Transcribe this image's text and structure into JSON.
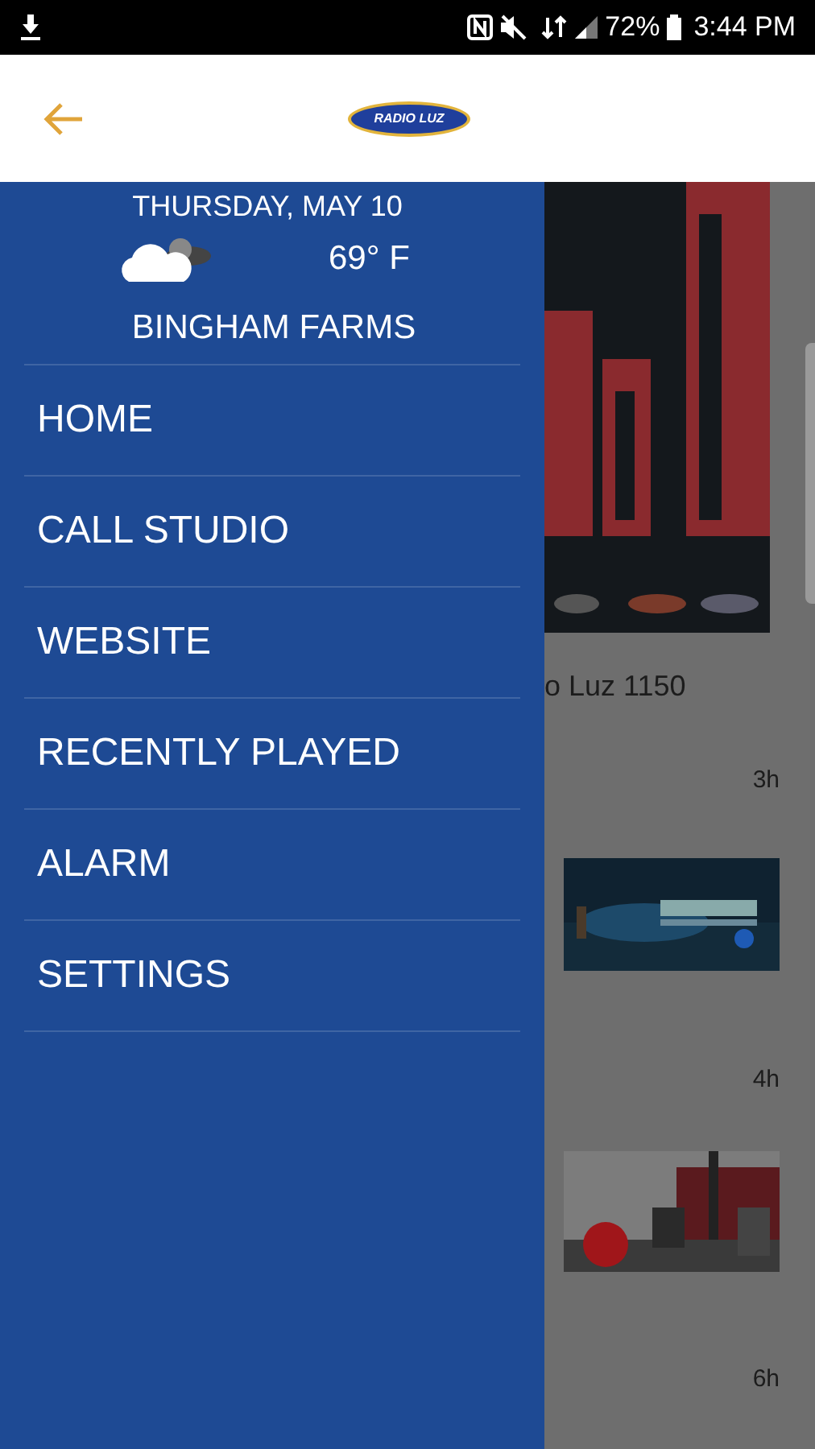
{
  "status_bar": {
    "battery": "72%",
    "time": "3:44 PM"
  },
  "app_bar": {
    "logo_text": "RADIO LUZ"
  },
  "drawer": {
    "date": "THURSDAY, MAY 10",
    "temperature": "69° F",
    "location": "BINGHAM FARMS",
    "items": [
      "HOME",
      "CALL STUDIO",
      "WEBSITE",
      "RECENTLY PLAYED",
      "ALARM",
      "SETTINGS"
    ]
  },
  "feed": {
    "caption": "o Luz 1150",
    "times": [
      "3h",
      "4h",
      "6h"
    ]
  }
}
